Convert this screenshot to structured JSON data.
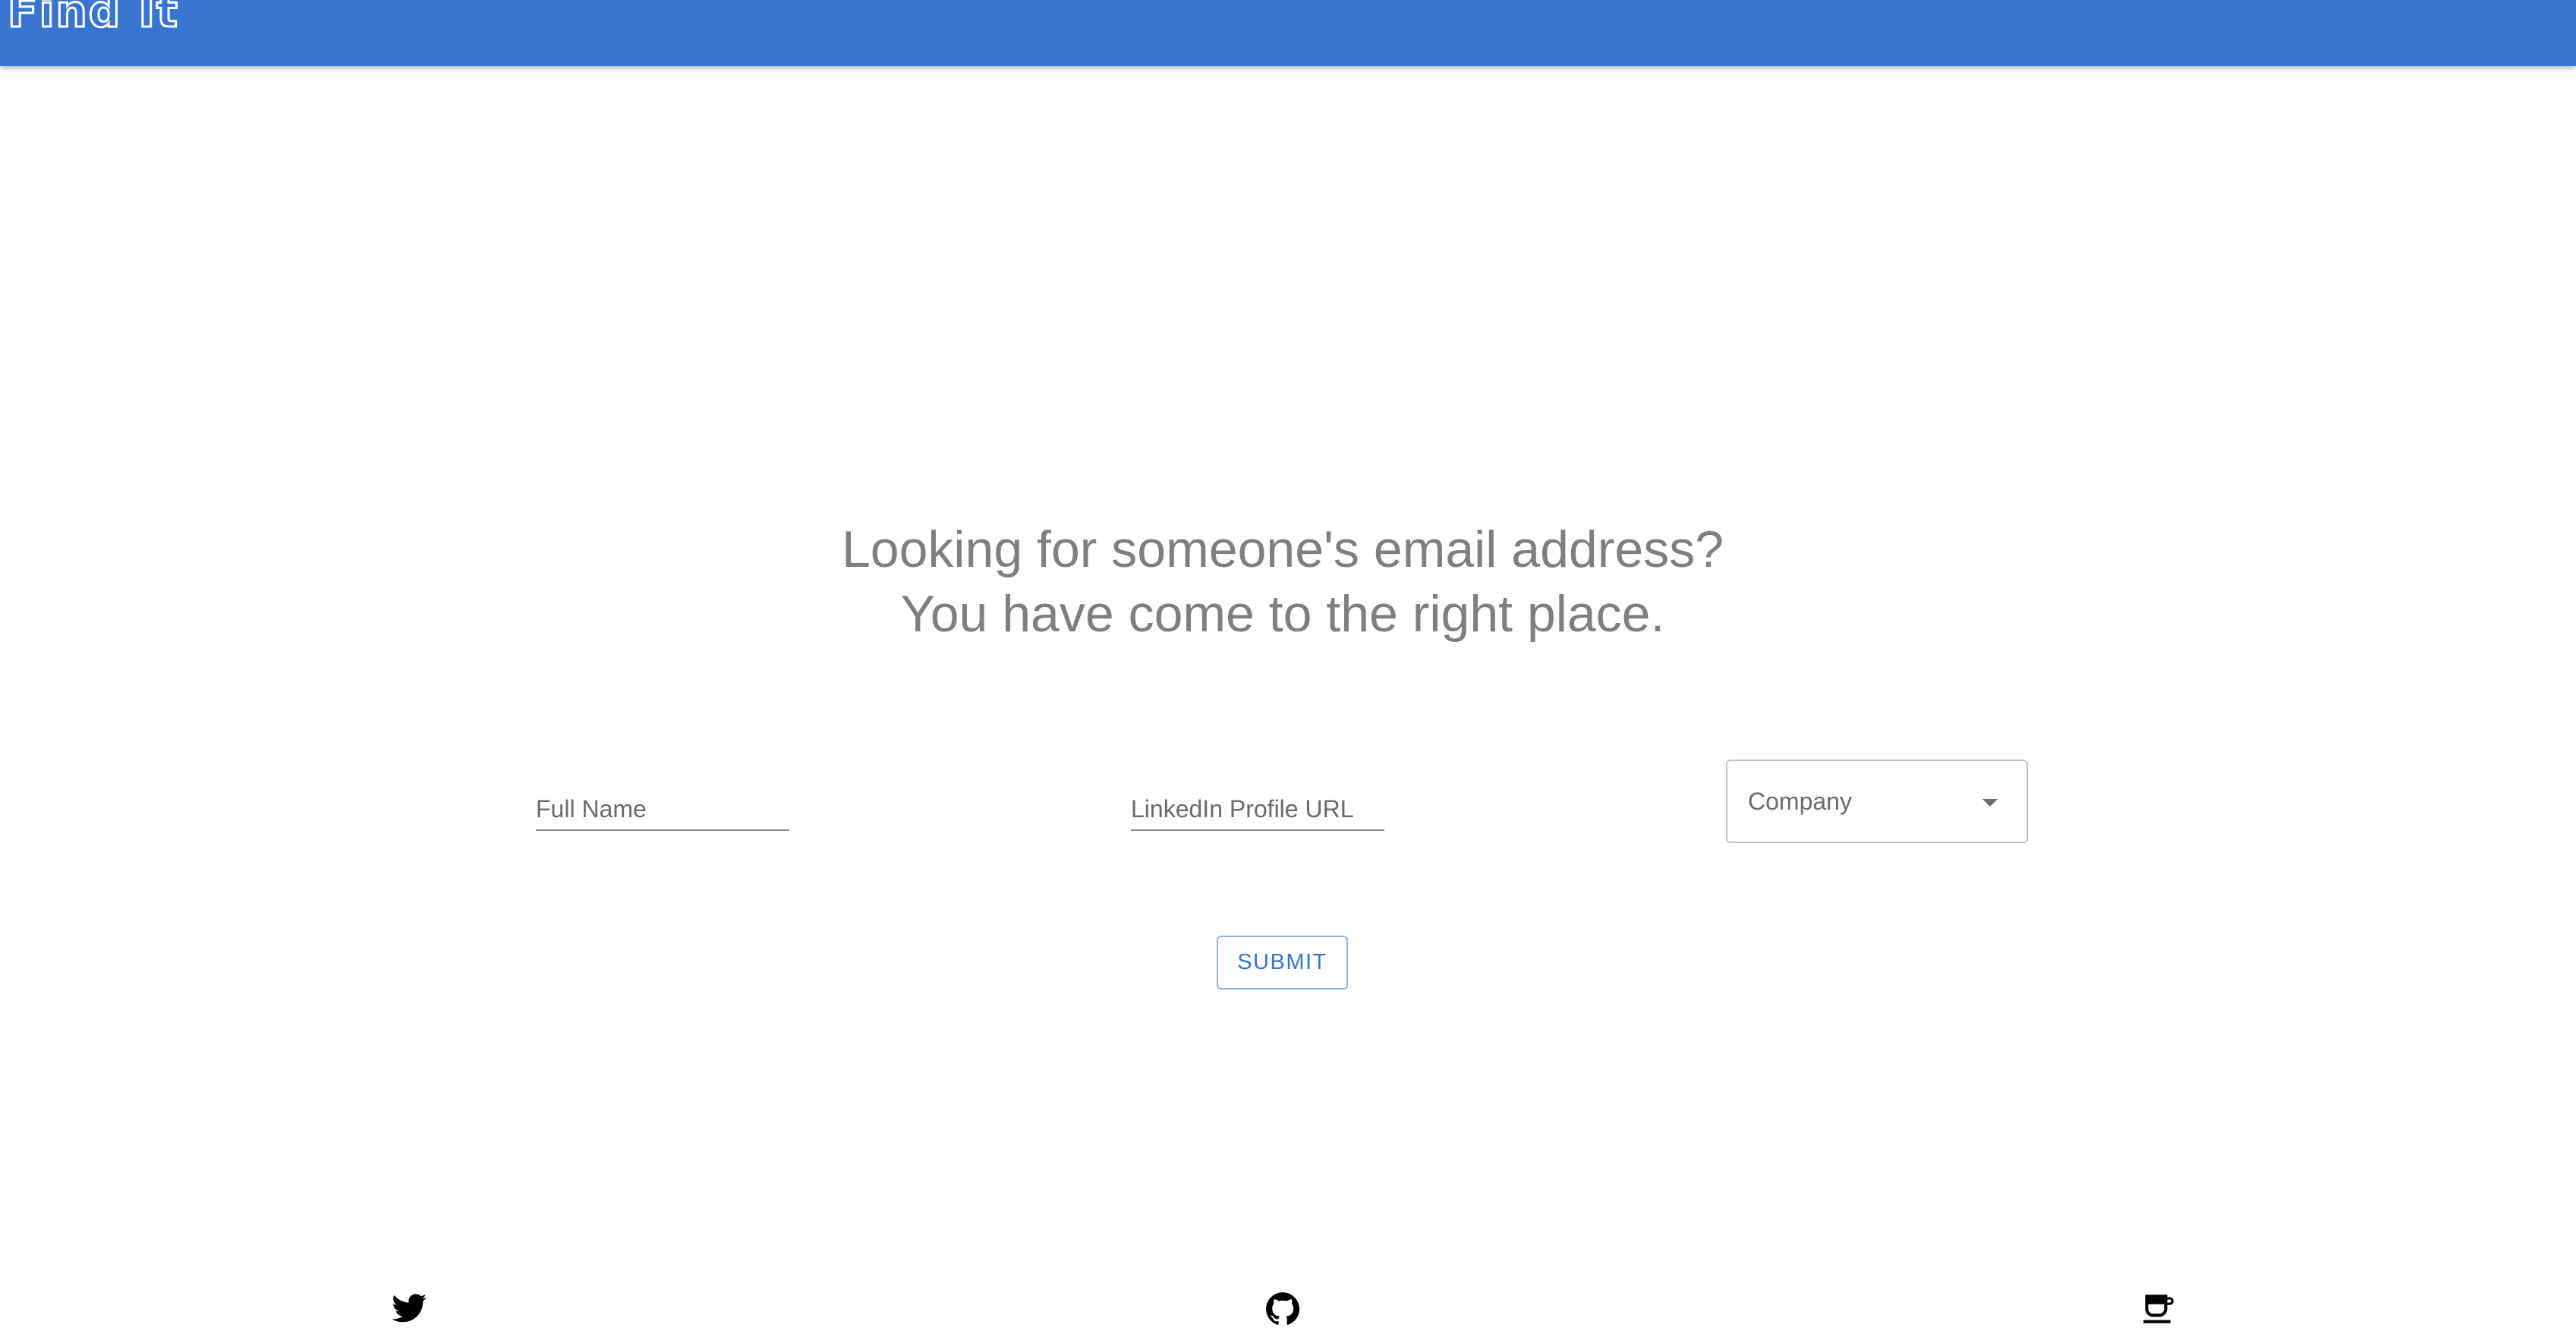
{
  "app": {
    "brand": "Find It",
    "brand_color": "#3875D0"
  },
  "hero": {
    "line1": "Looking for someone's email address?",
    "line2": "You have come to the right place."
  },
  "form": {
    "full_name_placeholder": "Full Name",
    "linkedin_placeholder": "LinkedIn Profile URL",
    "company_label": "Company",
    "submit_label": "SUBMIT"
  },
  "footer": {
    "icons": [
      "twitter-icon",
      "github-icon",
      "coffee-cup-icon"
    ]
  }
}
